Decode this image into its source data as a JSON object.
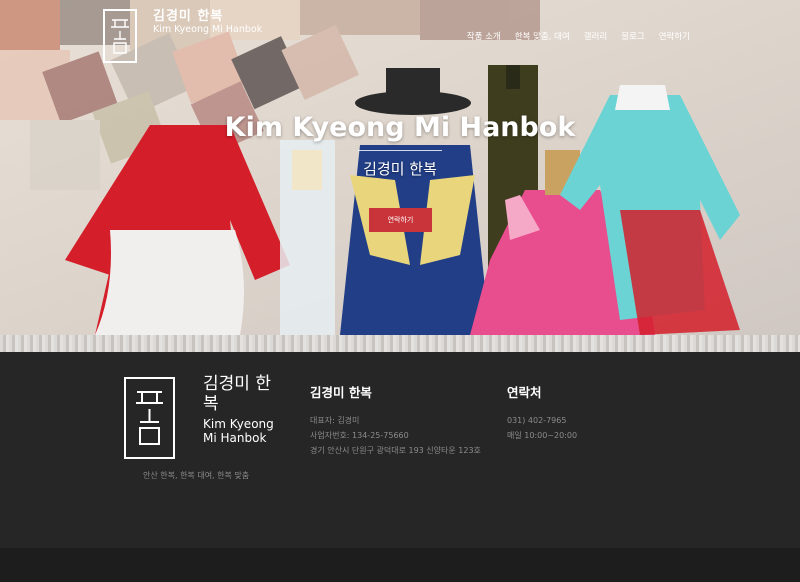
{
  "brand": {
    "name_ko": "김경미 한복",
    "name_en": "Kim Kyeong Mi Hanbok"
  },
  "nav": {
    "items": [
      "작품 소개",
      "한복 맞춤, 대여",
      "갤러리",
      "블로그",
      "연락하기"
    ]
  },
  "hero": {
    "title": "Kim Kyeong Mi Hanbok",
    "subtitle": "김경미 한복",
    "button_label": "연락하기"
  },
  "footer": {
    "logo_ko": "김경미 한복",
    "logo_en": "Kim Kyeong Mi Hanbok",
    "tagline": "안산 한복, 한복 대여, 한복 맞춤",
    "business": {
      "heading": "김경미 한복",
      "representative": "대표자: 김경미",
      "business_number": "사업자번호: 134-25-75660",
      "address": "경기 안산시 단원구 광덕대로 193 신양타운 123호"
    },
    "contact": {
      "heading": "연락처",
      "phone": "031) 402-7965",
      "hours": "매일 10:00~20:00"
    }
  },
  "colors": {
    "accent": "#c8343a",
    "footer_bg": "#262627"
  }
}
